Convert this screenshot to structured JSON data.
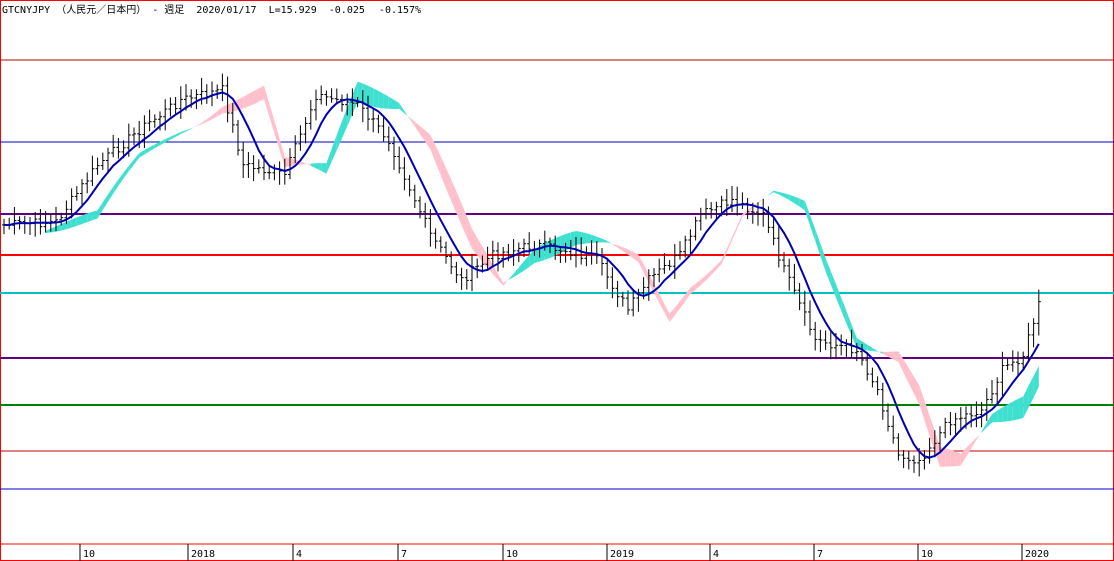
{
  "header": {
    "symbol": "GTCNYJPY",
    "name": "（人民元／日本円）",
    "period": "- 週足",
    "date": "2020/01/17",
    "last": "L=15.929",
    "change": "-0.025",
    "change_pct": "-0.157%"
  },
  "colors": {
    "background": "#ffffff",
    "frame": "#ff0000",
    "bar": "#000000",
    "cloud_bullish": "#ffc0cb",
    "cloud_bearish": "#40e0d0",
    "kijun": "#0000b0"
  },
  "chart_data": {
    "type": "ohlc-ichimoku",
    "x_ticks": [
      "10",
      "2018",
      "4",
      "7",
      "10",
      "2019",
      "4",
      "7",
      "10",
      "2020"
    ],
    "horizontal_lines": [
      {
        "color": "#c00000",
        "style": "thin"
      },
      {
        "color": "#0000c0",
        "style": "thin"
      },
      {
        "color": "#600080",
        "style": "thick"
      },
      {
        "color": "#ff0000",
        "style": "thick"
      },
      {
        "color": "#00c0c0",
        "style": "thick"
      },
      {
        "color": "#600080",
        "style": "thick"
      },
      {
        "color": "#008000",
        "style": "thick"
      },
      {
        "color": "#c00000",
        "style": "thin"
      },
      {
        "color": "#0000c0",
        "style": "thin"
      }
    ],
    "grid": false,
    "legend": "none",
    "notes": "weekly bars with moving-average line and shaded cloud; no y-axis labels printed"
  }
}
